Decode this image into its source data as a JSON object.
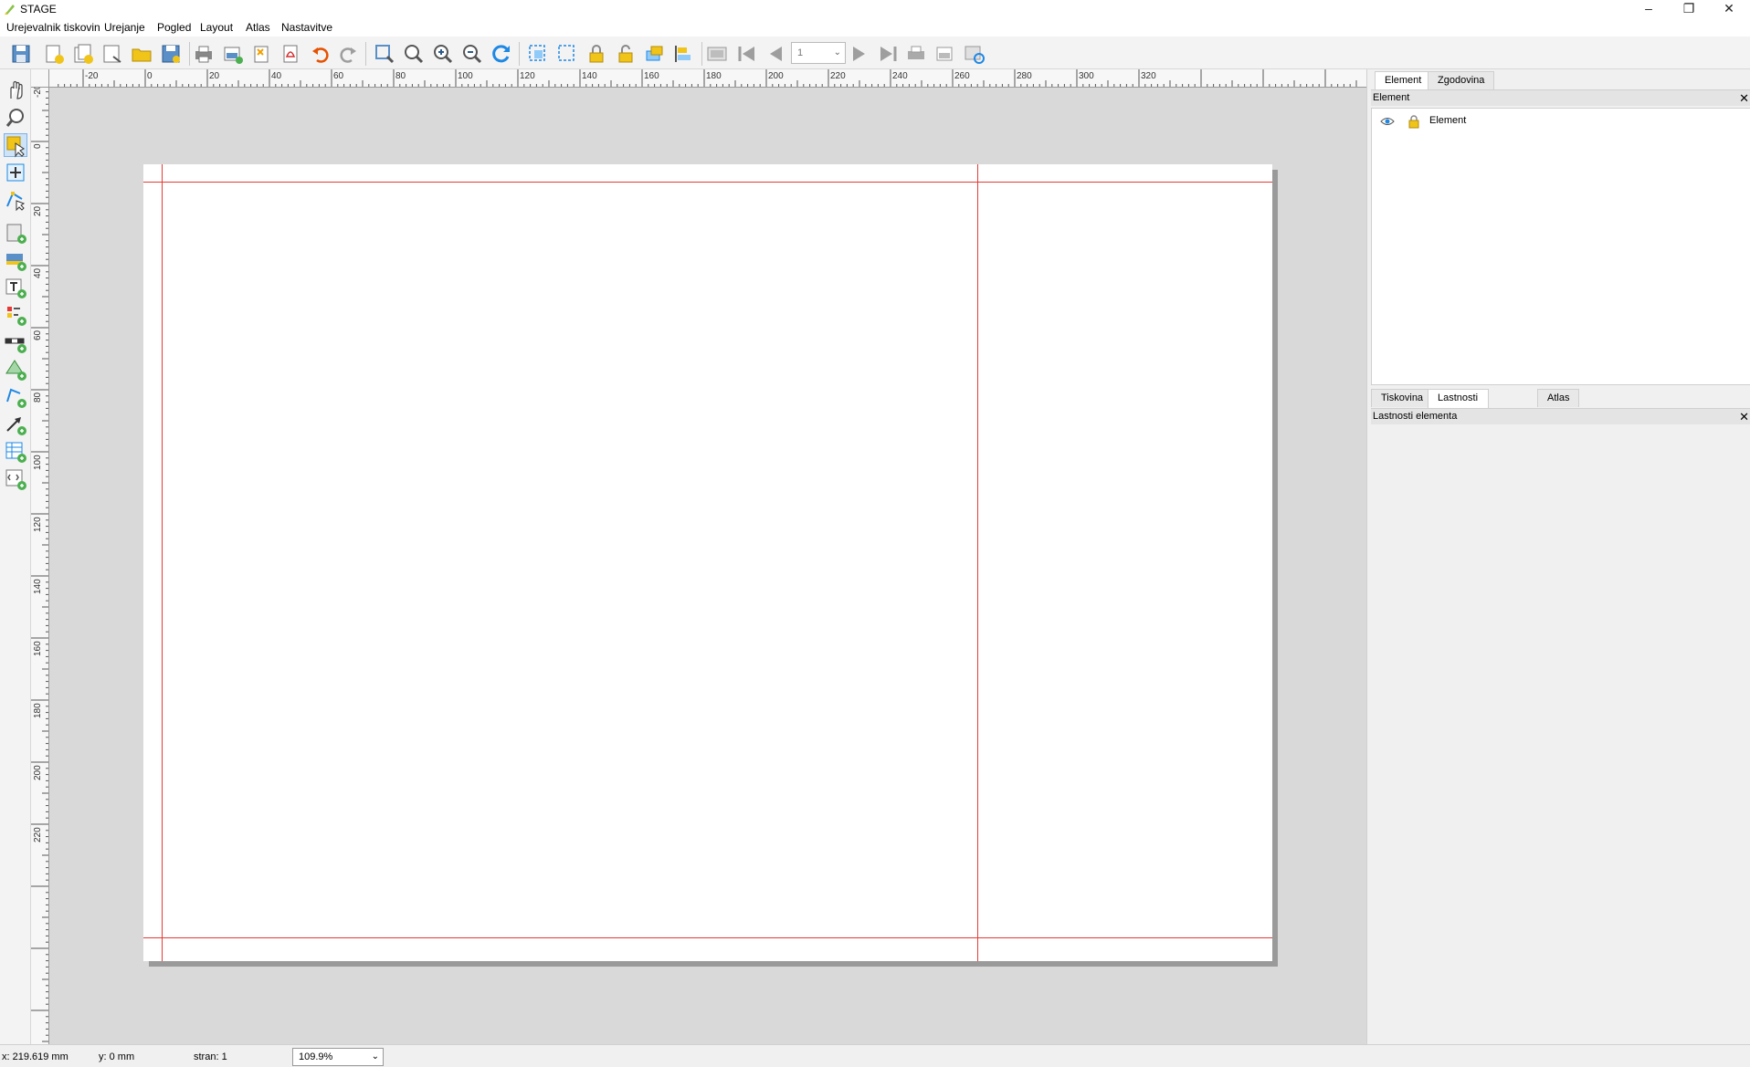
{
  "window": {
    "title": "STAGE"
  },
  "menu": [
    "Urejevalnik tiskovin",
    "Urejanje",
    "Pogled",
    "Layout",
    "Atlas",
    "Nastavitve"
  ],
  "toolbar": {
    "page_number": "1"
  },
  "ruler": {
    "h_labels": [
      "-20",
      "0",
      "20",
      "40",
      "60",
      "80",
      "100",
      "120",
      "140",
      "160",
      "180",
      "200",
      "220",
      "240",
      "260",
      "280",
      "300",
      "320"
    ],
    "v_labels": [
      "-20",
      "0",
      "20",
      "40",
      "60",
      "80",
      "100",
      "120",
      "140",
      "160",
      "180",
      "200",
      "220"
    ]
  },
  "items_panel": {
    "tabs": [
      "Element",
      "Zgodovina ukazov"
    ],
    "title": "Element",
    "items": [
      {
        "label": "Element",
        "visible": true,
        "locked": true
      }
    ]
  },
  "properties_panel": {
    "tabs": [
      "Tiskovina",
      "Lastnosti elementa",
      "Atlas"
    ],
    "title": "Lastnosti elementa"
  },
  "status": {
    "x": "x: 219.619 mm",
    "y": "y: 0 mm",
    "page": "stran: 1",
    "zoom": "109.9%"
  },
  "colors": {
    "guide": "#e53935",
    "canvas": "#d9d9d9",
    "accent": "#f0c419"
  }
}
